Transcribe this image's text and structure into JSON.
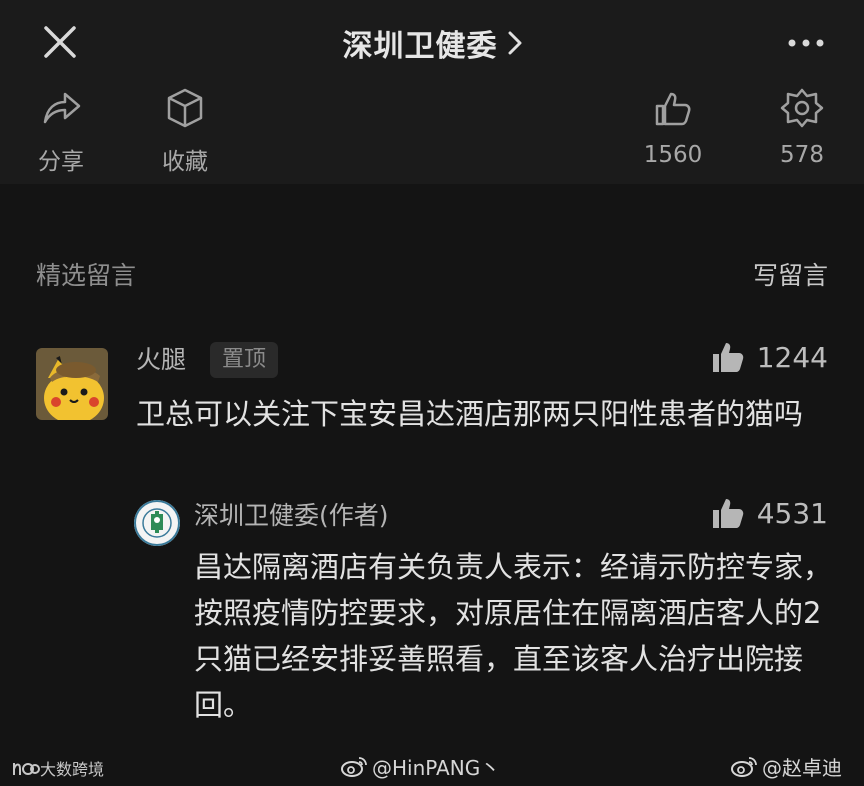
{
  "header": {
    "account_title": "深圳卫健委",
    "actions": [
      {
        "label": "分享",
        "icon": "share-icon"
      },
      {
        "label": "收藏",
        "icon": "box-icon"
      },
      {
        "label": "1560",
        "icon": "thumb-up-icon"
      },
      {
        "label": "578",
        "icon": "wow-icon"
      }
    ]
  },
  "comments": {
    "section_title": "精选留言",
    "write_label": "写留言",
    "top_comment": {
      "nickname": "火腿",
      "badge": "置顶",
      "likes": "1244",
      "text": "卫总可以关注下宝安昌达酒店那两只阳性患者的猫吗"
    },
    "author_reply": {
      "name": "深圳卫健委(作者)",
      "likes": "4531",
      "text": "昌达隔离酒店有关负责人表示：经请示防控专家，按照疫情防控要求，对原居住在隔离酒店客人的2只猫已经安排妥善照看，直至该客人治疗出院接回。"
    }
  },
  "watermarks": {
    "left": "大数跨境",
    "weibo_1": "@HinPANG丶",
    "weibo_2": "@赵卓迪"
  },
  "colors": {
    "background": "#141414",
    "header_bg": "#1b1b1b",
    "text_primary": "#e2e2e2",
    "text_secondary": "#a8a8a8"
  }
}
